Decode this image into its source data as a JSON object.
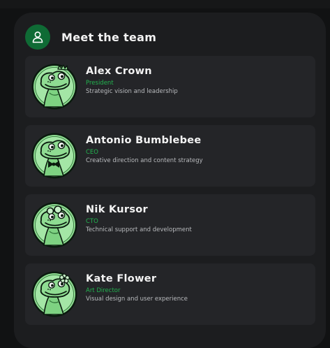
{
  "header": {
    "title": "Meet the team",
    "icon": "user-icon"
  },
  "colors": {
    "accent": "#22b34f",
    "icon_bg": "#0f6b35",
    "card_bg": "#242528",
    "panel_bg": "#1c1d1f"
  },
  "members": [
    {
      "name": "Alex Crown",
      "role": "President",
      "description": "Strategic vision and leadership",
      "avatar": "frog-mascot-with-crown-icon"
    },
    {
      "name": "Antonio Bumblebee",
      "role": "CEO",
      "description": "Creative direction and content strategy",
      "avatar": "frog-mascot-with-bowtie-icon"
    },
    {
      "name": "Nik Kursor",
      "role": "CTO",
      "description": "Technical support and development",
      "avatar": "frog-mascot-with-goggles-icon"
    },
    {
      "name": "Kate Flower",
      "role": "Art Director",
      "description": "Visual design and user experience",
      "avatar": "frog-mascot-with-flower-icon"
    }
  ]
}
